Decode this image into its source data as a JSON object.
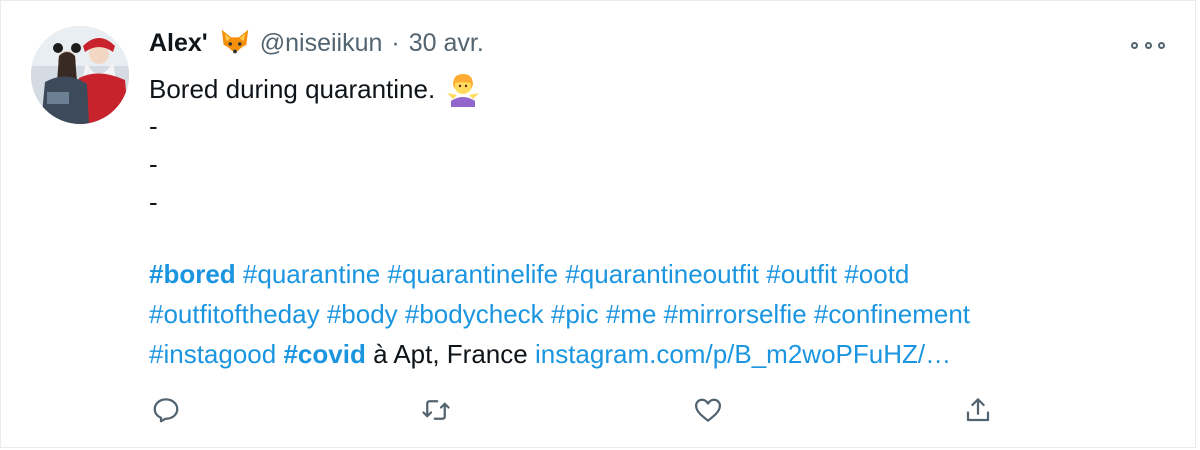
{
  "tweet": {
    "display_name": "Alex'",
    "name_emoji": "fox-face",
    "handle": "@niseiikun",
    "separator": "·",
    "date": "30 avr.",
    "text_line1": "Bored during quarantine.",
    "text_emoji": "person-shrugging",
    "dash1": "-",
    "dash2": "-",
    "dash3": "-",
    "tags_line1": [
      "#bored",
      "#quarantine",
      "#quarantinelife",
      "#quarantineoutfit",
      "#outfit",
      "#ootd"
    ],
    "tags_line2": [
      "#outfitoftheday",
      "#body",
      "#bodycheck",
      "#pic",
      "#me",
      "#mirrorselfie",
      "#confinement"
    ],
    "tags_line3": [
      "#instagood",
      "#covid"
    ],
    "location": "à Apt, France",
    "url": "instagram.com/p/B_m2woPFuHZ/…"
  },
  "actions": {
    "reply_icon": "reply-icon",
    "retweet_icon": "retweet-icon",
    "like_icon": "heart-icon",
    "share_icon": "share-icon"
  },
  "colors": {
    "link": "#1b95e0",
    "muted": "#536471",
    "text": "#0f1419"
  }
}
